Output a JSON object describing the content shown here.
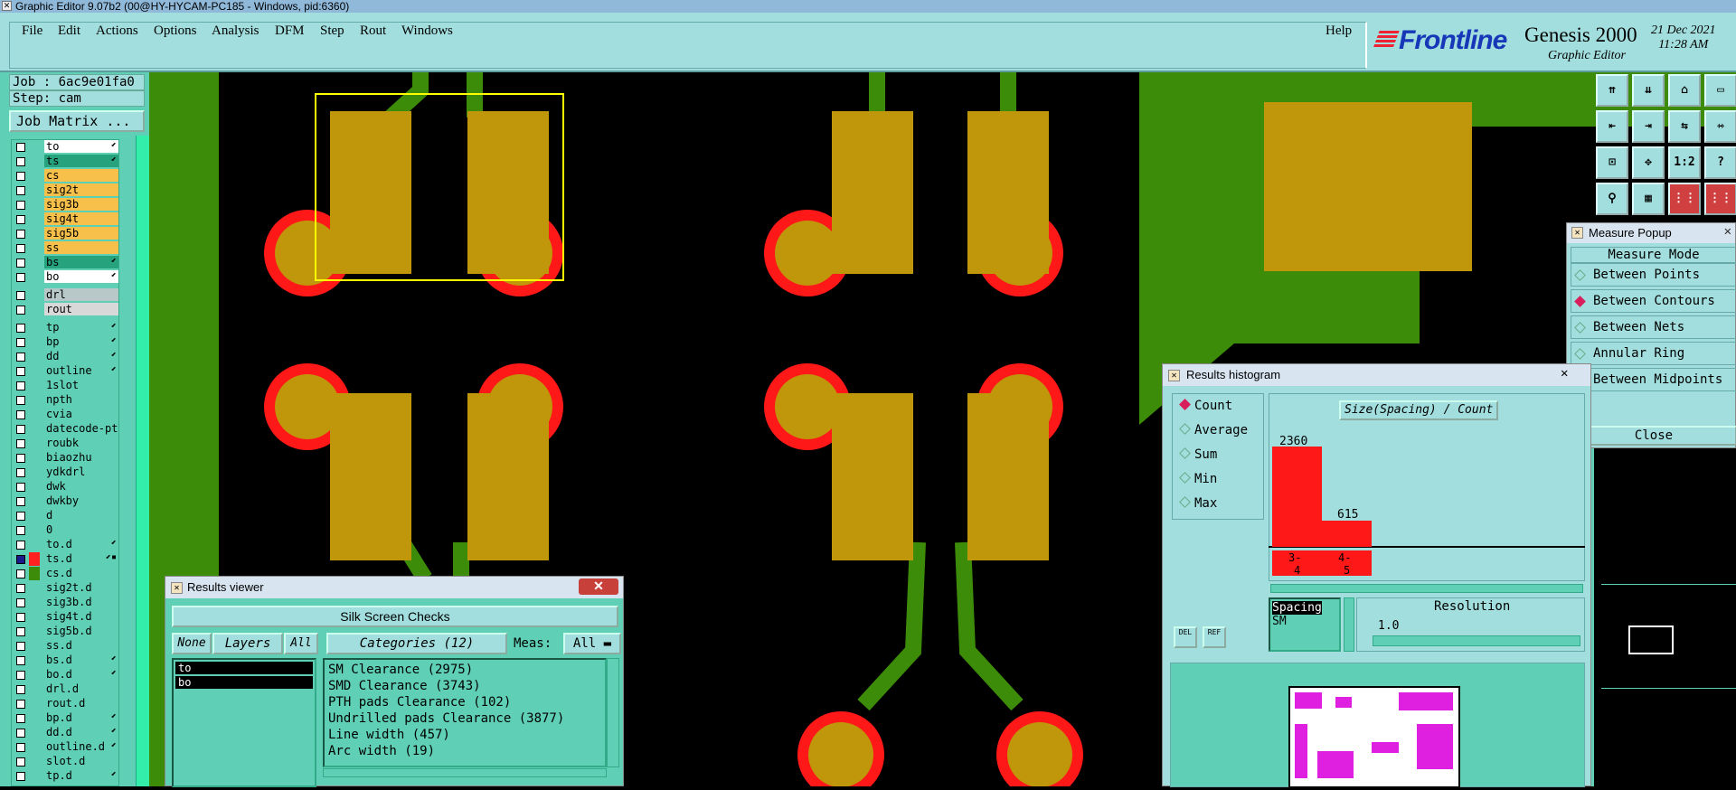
{
  "window": {
    "title": "Graphic Editor 9.07b2 (00@HY-HYCAM-PC185 - Windows, pid:6360)"
  },
  "menu": {
    "items": [
      "File",
      "Edit",
      "Actions",
      "Options",
      "Analysis",
      "DFM",
      "Step",
      "Rout",
      "Windows"
    ],
    "help": "Help"
  },
  "brand": {
    "logo": "Frontline",
    "product": "Genesis 2000",
    "subtitle": "Graphic Editor",
    "date": "21 Dec 2021",
    "time": "11:28 AM"
  },
  "job": {
    "job_label": "Job : 6ac9e01fa0",
    "step_label": "Step: cam",
    "matrix_button": "Job Matrix ..."
  },
  "layers": [
    {
      "name": "to",
      "color": "#ffffff",
      "mark": "⬋"
    },
    {
      "name": "ts",
      "color": "#26a37c",
      "mark": "⬋"
    },
    {
      "name": "cs",
      "color": "#f7c04a",
      "mark": ""
    },
    {
      "name": "sig2t",
      "color": "#f7c04a",
      "mark": ""
    },
    {
      "name": "sig3b",
      "color": "#f7c04a",
      "mark": ""
    },
    {
      "name": "sig4t",
      "color": "#f7c04a",
      "mark": ""
    },
    {
      "name": "sig5b",
      "color": "#f7c04a",
      "mark": ""
    },
    {
      "name": "ss",
      "color": "#f7c04a",
      "mark": ""
    },
    {
      "name": "bs",
      "color": "#26a37c",
      "mark": "⬋"
    },
    {
      "name": "bo",
      "color": "#ffffff",
      "mark": "⬋"
    },
    {
      "name": "drl",
      "color": "#b8c8c8",
      "mark": ""
    },
    {
      "name": "rout",
      "color": "#d8d8d8",
      "mark": ""
    },
    {
      "name": "tp",
      "color": "#5fcfb5",
      "mark": "⬋"
    },
    {
      "name": "bp",
      "color": "#5fcfb5",
      "mark": "⬋"
    },
    {
      "name": "dd",
      "color": "#5fcfb5",
      "mark": "⬋"
    },
    {
      "name": "outline",
      "color": "#5fcfb5",
      "mark": "⬋"
    },
    {
      "name": "1slot",
      "color": "#5fcfb5",
      "mark": ""
    },
    {
      "name": "npth",
      "color": "#5fcfb5",
      "mark": ""
    },
    {
      "name": "cvia",
      "color": "#5fcfb5",
      "mark": ""
    },
    {
      "name": "datecode-pte",
      "color": "#5fcfb5",
      "mark": ""
    },
    {
      "name": "roubk",
      "color": "#5fcfb5",
      "mark": ""
    },
    {
      "name": "biaozhu",
      "color": "#5fcfb5",
      "mark": ""
    },
    {
      "name": "ydkdrl",
      "color": "#5fcfb5",
      "mark": ""
    },
    {
      "name": "dwk",
      "color": "#5fcfb5",
      "mark": ""
    },
    {
      "name": "dwkby",
      "color": "#5fcfb5",
      "mark": ""
    },
    {
      "name": "d",
      "color": "#5fcfb5",
      "mark": ""
    },
    {
      "name": "0",
      "color": "#5fcfb5",
      "mark": ""
    },
    {
      "name": "to.d",
      "color": "#5fcfb5",
      "mark": "⬋"
    },
    {
      "name": "ts.d",
      "color": "#5fcfb5",
      "mark": "⬋▪"
    },
    {
      "name": "cs.d",
      "color": "#5fcfb5",
      "mark": ""
    },
    {
      "name": "sig2t.d",
      "color": "#5fcfb5",
      "mark": ""
    },
    {
      "name": "sig3b.d",
      "color": "#5fcfb5",
      "mark": ""
    },
    {
      "name": "sig4t.d",
      "color": "#5fcfb5",
      "mark": ""
    },
    {
      "name": "sig5b.d",
      "color": "#5fcfb5",
      "mark": ""
    },
    {
      "name": "ss.d",
      "color": "#5fcfb5",
      "mark": ""
    },
    {
      "name": "bs.d",
      "color": "#5fcfb5",
      "mark": "⬋"
    },
    {
      "name": "bo.d",
      "color": "#5fcfb5",
      "mark": "⬋"
    },
    {
      "name": "drl.d",
      "color": "#5fcfb5",
      "mark": ""
    },
    {
      "name": "rout.d",
      "color": "#5fcfb5",
      "mark": ""
    },
    {
      "name": "bp.d",
      "color": "#5fcfb5",
      "mark": "⬋"
    },
    {
      "name": "dd.d",
      "color": "#5fcfb5",
      "mark": "⬋"
    },
    {
      "name": "outline.d",
      "color": "#5fcfb5",
      "mark": "⬋"
    },
    {
      "name": "slot.d",
      "color": "#5fcfb5",
      "mark": ""
    },
    {
      "name": "tp.d",
      "color": "#5fcfb5",
      "mark": "⬋"
    }
  ],
  "results_viewer": {
    "title": "Results viewer",
    "header": "Silk Screen Checks",
    "none_btn": "None",
    "layers_btn": "Layers",
    "all_btn": "All",
    "categories_label": "Categories (12)",
    "meas_label": "Meas:",
    "meas_value": "All",
    "layers": [
      "to",
      "bo"
    ],
    "categories": [
      "SM Clearance (2975)",
      "SMD Clearance (3743)",
      "PTH pads Clearance (102)",
      "Undrilled pads Clearance (3877)",
      "Line width (457)",
      "Arc width (19)"
    ]
  },
  "histogram": {
    "title": "Results histogram",
    "modes": [
      "Count",
      "Average",
      "Sum",
      "Min",
      "Max"
    ],
    "selected_mode": "Count",
    "chart_title": "Size(Spacing) / Count",
    "bars": [
      {
        "label": "3-\n4",
        "value": 2360
      },
      {
        "label": "4-\n5",
        "value": 615
      }
    ],
    "spacing_items": [
      "Spacing",
      "SM"
    ],
    "resolution_label": "Resolution",
    "resolution_value": "1.0",
    "del_btn": "DEL",
    "ref_btn": "REF"
  },
  "measure_popup": {
    "title": "Measure Popup",
    "mode_label": "Measure Mode",
    "options": [
      "Between Points",
      "Between Contours",
      "Between Nets",
      "Annular Ring",
      "Between Midpoints"
    ],
    "selected": "Between Contours",
    "close": "Close"
  },
  "tools": [
    "⇈",
    "⇊",
    "⌂",
    "▭",
    "⇤",
    "⇥",
    "⇆",
    "⇿",
    "⊡",
    "✥",
    "1:2",
    "?",
    "⚲",
    "▦",
    "⋮⋮",
    "⋮⋮"
  ],
  "colors": {
    "panel": "#5fcfb5",
    "menu": "#a2dede",
    "copper": "#c0960a",
    "mask": "#ff1818",
    "trace": "#3c8c0a",
    "highlight": "#ffff00"
  }
}
